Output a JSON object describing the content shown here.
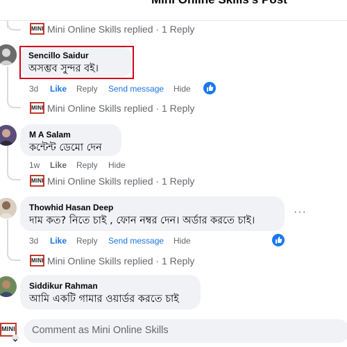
{
  "header": {
    "title": "Mini Online Skills's Post"
  },
  "page_name": "Mini Online Skills",
  "brand_logo_text": "MINI",
  "comments": [
    {
      "replied_text": "Mini Online Skills replied · 1 Reply"
    },
    {
      "author": "Sencillo Saidur",
      "text": "অসম্ভব সুন্দর বই।",
      "time": "3d",
      "actions": [
        "Like",
        "Reply",
        "Send message",
        "Hide"
      ],
      "replied_text": "Mini Online Skills replied · 1 Reply",
      "highlighted": true
    },
    {
      "author": "M A Salam",
      "text": "কন্টেন্ট ডেমো দেন",
      "time": "1w",
      "actions": [
        "Like",
        "Reply",
        "Hide"
      ],
      "replied_text": "Mini Online Skills replied · 1 Reply"
    },
    {
      "author": "Thowhid Hasan Deep",
      "text": "দাম কত? নিতে চাই , ফোন নম্বর দেন। অর্ডার করতে চাই।",
      "time": "3d",
      "actions": [
        "Like",
        "Reply",
        "Send message",
        "Hide"
      ],
      "replied_text": "Mini Online Skills replied · 1 Reply",
      "more": "···"
    },
    {
      "author": "Siddikur Rahman",
      "text": "আমি একটি গামার ওয়ার্ডর করতে চাই"
    }
  ],
  "composer": {
    "placeholder": "Comment as Mini Online Skills"
  },
  "colors": {
    "link_blue": "#1b74e4",
    "highlight_red": "#d0021b",
    "bubble_gray": "#f0f2f5"
  }
}
